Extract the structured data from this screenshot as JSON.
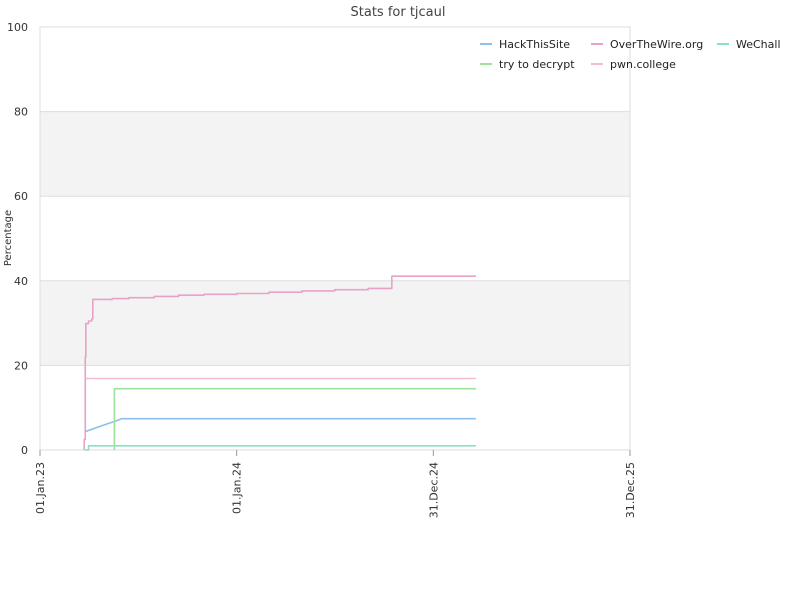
{
  "chart_data": {
    "type": "line",
    "title": "Stats for tjcaul",
    "xlabel": "",
    "ylabel": "Percentage",
    "ylim": [
      0,
      100
    ],
    "yticks": [
      0,
      20,
      40,
      60,
      80,
      100
    ],
    "ytick_labels": [
      "0",
      "20",
      "40",
      "60",
      "80",
      "100"
    ],
    "xlim": [
      "2023-01-01",
      "2025-12-31"
    ],
    "xticks": [
      "2023-01-01",
      "2024-01-01",
      "2024-12-31",
      "2025-12-31"
    ],
    "xtick_labels": [
      "01.Jan.23",
      "01.Jan.24",
      "31.Dec.24",
      "31.Dec.25"
    ],
    "grid": true,
    "bands": [
      {
        "from": 20,
        "to": 40
      },
      {
        "from": 60,
        "to": 80
      }
    ],
    "legend_position": "top-right",
    "series": [
      {
        "name": "HackThisSite",
        "color": "#8ebfee",
        "points": [
          [
            "2023-03-25",
            4.3
          ],
          [
            "2023-04-25",
            5.7
          ],
          [
            "2023-05-27",
            7.1
          ],
          [
            "2023-06-01",
            7.4
          ],
          [
            "2025-03-20",
            7.4
          ]
        ]
      },
      {
        "name": "OverTheWire.org",
        "color": "#e8a2c8",
        "points": [
          [
            "2023-03-24",
            0
          ],
          [
            "2023-03-24",
            2.5
          ],
          [
            "2023-03-26",
            2.5
          ],
          [
            "2023-03-26",
            22
          ],
          [
            "2023-03-27",
            22
          ],
          [
            "2023-03-27",
            29.9
          ],
          [
            "2023-04-01",
            29.9
          ],
          [
            "2023-04-01",
            30.5
          ],
          [
            "2023-04-07",
            30.5
          ],
          [
            "2023-04-07",
            31
          ],
          [
            "2023-04-09",
            31
          ],
          [
            "2023-04-09",
            35.6
          ],
          [
            "2023-05-15",
            35.6
          ],
          [
            "2023-05-15",
            35.8
          ],
          [
            "2023-06-15",
            35.8
          ],
          [
            "2023-06-15",
            36.0
          ],
          [
            "2023-08-01",
            36.0
          ],
          [
            "2023-08-01",
            36.3
          ],
          [
            "2023-09-15",
            36.3
          ],
          [
            "2023-09-15",
            36.6
          ],
          [
            "2023-11-01",
            36.6
          ],
          [
            "2023-11-01",
            36.8
          ],
          [
            "2024-01-01",
            36.8
          ],
          [
            "2024-01-01",
            37.0
          ],
          [
            "2024-03-01",
            37.0
          ],
          [
            "2024-03-01",
            37.3
          ],
          [
            "2024-05-01",
            37.3
          ],
          [
            "2024-05-01",
            37.6
          ],
          [
            "2024-07-01",
            37.6
          ],
          [
            "2024-07-01",
            37.9
          ],
          [
            "2024-09-01",
            37.9
          ],
          [
            "2024-09-01",
            38.2
          ],
          [
            "2024-10-15",
            38.2
          ],
          [
            "2024-10-15",
            41.1
          ],
          [
            "2025-03-20",
            41.1
          ]
        ]
      },
      {
        "name": "WeChall",
        "color": "#88e0c8",
        "points": [
          [
            "2023-03-25",
            0
          ],
          [
            "2023-04-01",
            0
          ],
          [
            "2023-04-01",
            1.0
          ],
          [
            "2025-03-20",
            1.0
          ]
        ]
      },
      {
        "name": "try to decrypt",
        "color": "#9be39b",
        "points": [
          [
            "2023-05-19",
            0
          ],
          [
            "2023-05-19",
            14.5
          ],
          [
            "2025-03-20",
            14.5
          ]
        ]
      },
      {
        "name": "pwn.college",
        "color": "#f5bcd0",
        "points": [
          [
            "2023-03-27",
            16.9
          ],
          [
            "2025-03-20",
            16.9
          ]
        ]
      }
    ]
  }
}
